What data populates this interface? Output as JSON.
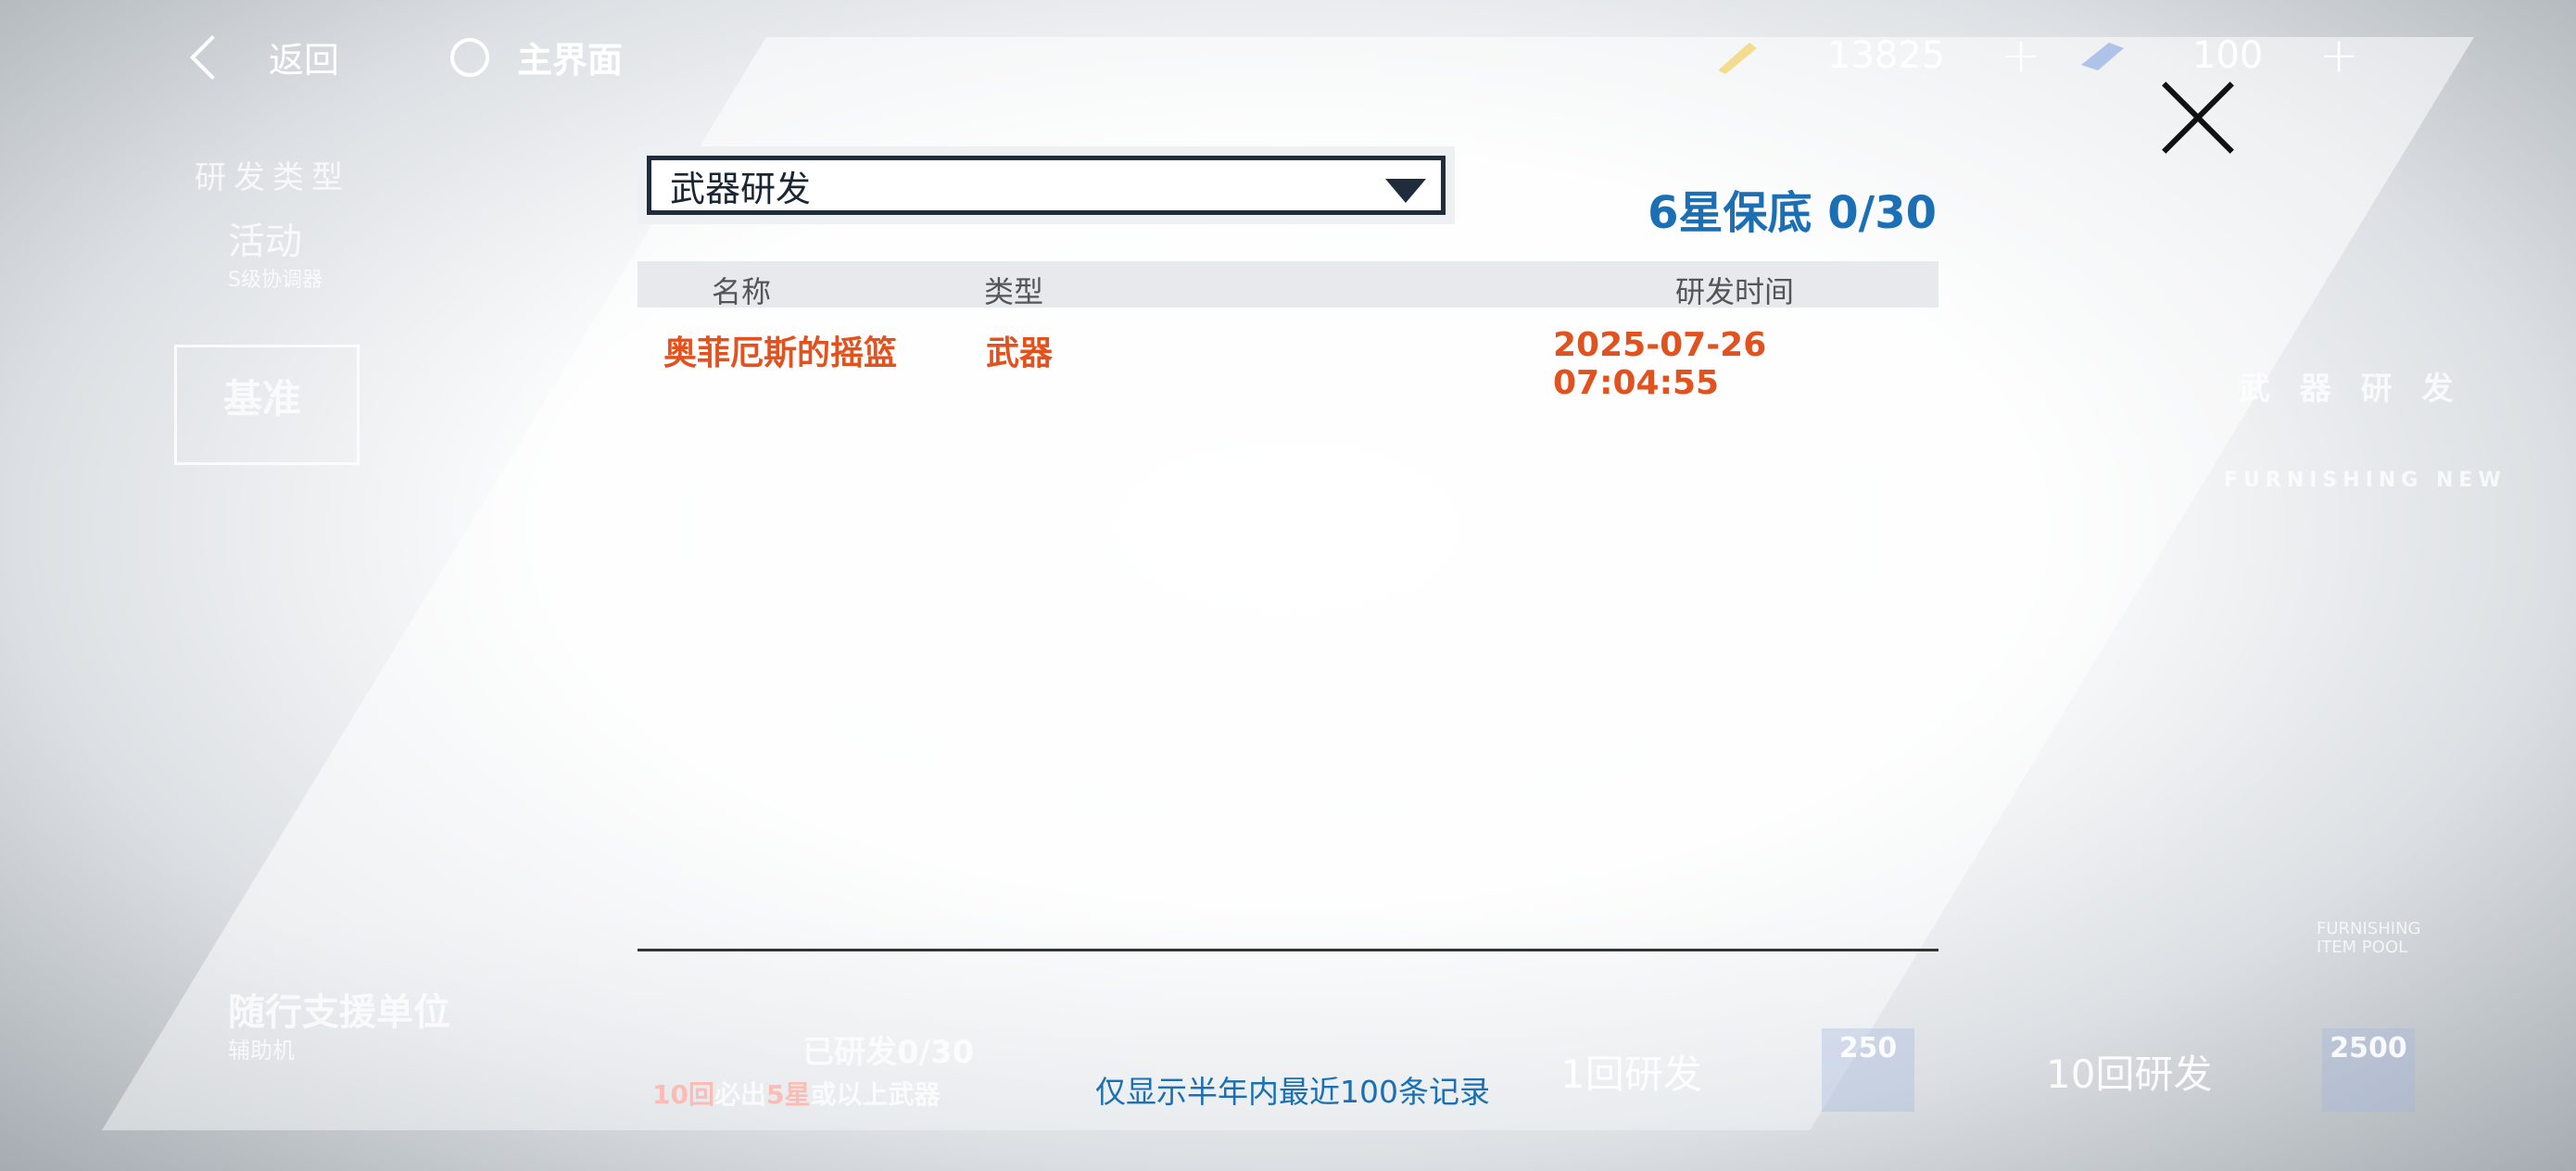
{
  "topbar": {
    "back_label": "返回",
    "home_label": "主界面",
    "currency_1": "13825",
    "currency_2": "100",
    "plus": "+"
  },
  "left_panel": {
    "section_title": "研发类型",
    "activity": "活动",
    "activity_sub": "S级协调器",
    "standard": "基准",
    "support": "随行支援单位",
    "support_sub": "辅助机",
    "guarantee_1": "已研发0/30",
    "guarantee_2_a": "10回",
    "guarantee_2_b": "必出",
    "guarantee_2_c": "5星",
    "guarantee_2_d": "或以上武器"
  },
  "right_panel": {
    "title": "武 器 研 发",
    "sub1": "FURNISHING NEW",
    "sub2": "FURNISHING",
    "sub3": "ITEM POOL"
  },
  "dialog": {
    "dropdown_value": "武器研发",
    "pity": "6星保底 0/30",
    "columns": [
      "名称",
      "类型",
      "研发时间"
    ],
    "rows": [
      {
        "name": "奥菲厄斯的摇篮",
        "type": "武器",
        "time": "2025-07-26 07:04:55"
      }
    ],
    "note": "仅显示半年内最近100条记录"
  },
  "actions": {
    "single": "1回研发",
    "single_cost": "250",
    "ten": "10回研发",
    "ten_cost": "2500"
  },
  "colors": {
    "accent_blue": "#1a6fb5",
    "record_orange": "#e1521f"
  }
}
